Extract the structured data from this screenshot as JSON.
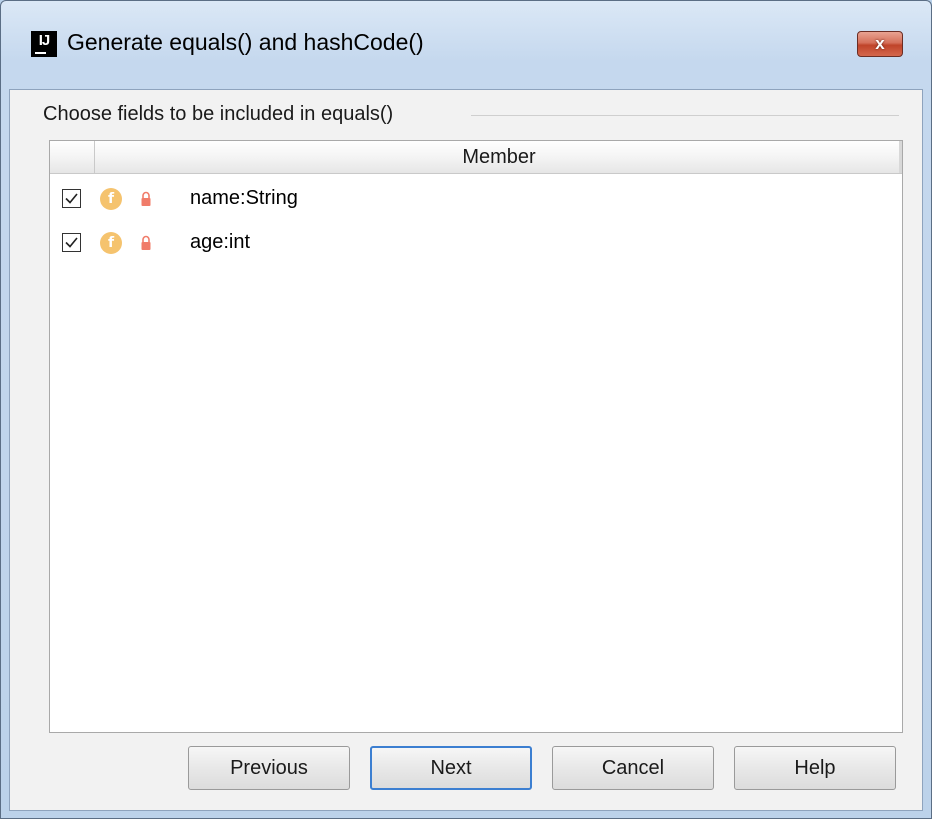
{
  "window": {
    "icon_text": "IJ",
    "title": "Generate equals() and hashCode()",
    "close_label": "x"
  },
  "section": {
    "label": "Choose fields to be included in equals()"
  },
  "table": {
    "column_member": "Member",
    "rows": [
      {
        "checked": true,
        "icon": "field-icon",
        "lock": "lock-icon",
        "member": "name:String"
      },
      {
        "checked": true,
        "icon": "field-icon",
        "lock": "lock-icon",
        "member": "age:int"
      }
    ],
    "field_icon_letter": "f"
  },
  "buttons": {
    "previous": "Previous",
    "next": "Next",
    "cancel": "Cancel",
    "help": "Help"
  },
  "colors": {
    "field_icon": "#f5c36e",
    "lock_icon": "#f07c6a",
    "default_button_border": "#3c7fd1",
    "close_button": "#c0442a"
  }
}
